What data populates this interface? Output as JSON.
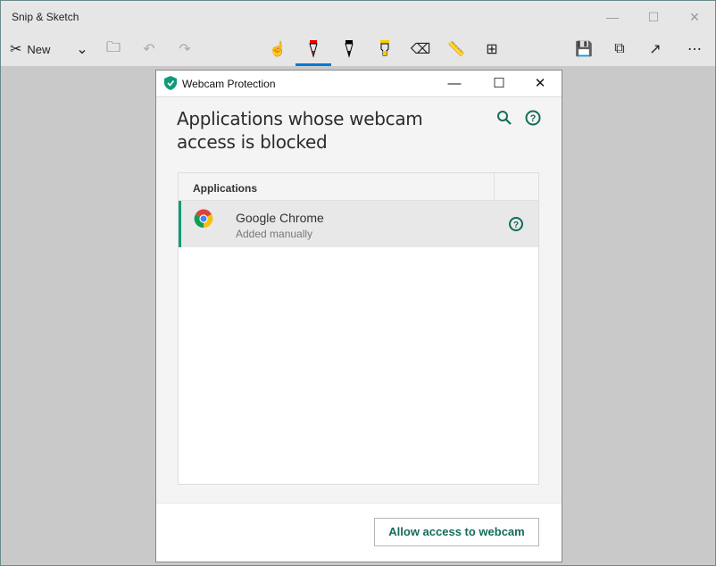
{
  "app": {
    "title": "Snip & Sketch",
    "new_label": "New"
  },
  "toolbar": {
    "icons": [
      "new-snip-icon",
      "chevron-down-icon",
      "open-folder-icon",
      "undo-icon",
      "redo-icon",
      "touch-writing-icon",
      "ballpoint-pen-icon",
      "pencil-icon",
      "highlighter-icon",
      "eraser-icon",
      "ruler-icon",
      "crop-icon",
      "save-icon",
      "copy-icon",
      "share-icon",
      "more-icon"
    ]
  },
  "dialog": {
    "title": "Webcam Protection",
    "heading": "Applications whose webcam access is blocked",
    "table": {
      "header": "Applications",
      "rows": [
        {
          "name": "Google Chrome",
          "status": "Added manually"
        }
      ]
    },
    "allow_button": "Allow access to webcam",
    "accent": "#0f9a7a"
  }
}
